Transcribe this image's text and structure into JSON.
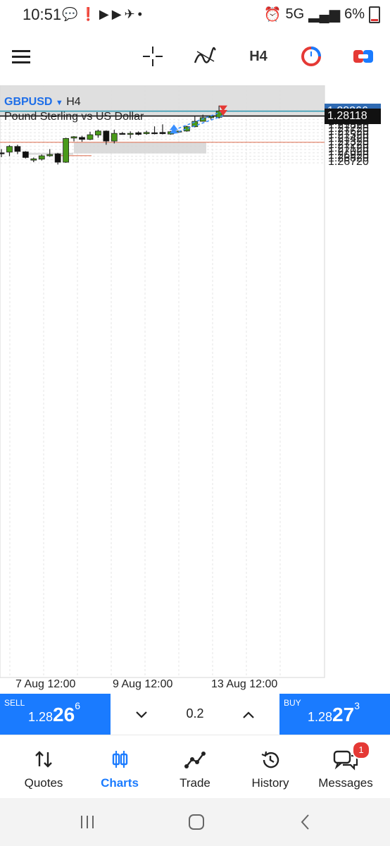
{
  "status": {
    "time": "10:51",
    "left_icons": [
      "chat-bubble-icon",
      "alert-icon",
      "youtube-icon",
      "youtube-icon",
      "flight-icon",
      "dot-icon"
    ],
    "network": "5G",
    "battery": "6%"
  },
  "toolbar": {
    "menu_icon": "menu-icon",
    "crosshair_icon": "crosshair-icon",
    "indicators_icon": "indicators-icon",
    "timeframe": "H4",
    "clock_icon": "trade-clock-icon",
    "trade_icon": "one-click-trade-icon"
  },
  "chart": {
    "symbol": "GBPUSD",
    "timeframe": "H4",
    "description": "Pound Sterling vs US Dollar",
    "price_ticks": [
      "1.28320",
      "1.28220",
      "1.28020",
      "1.27920",
      "1.27820",
      "1.27720",
      "1.27620",
      "1.27520",
      "1.27420",
      "1.27320",
      "1.27220",
      "1.27120",
      "1.27020",
      "1.26920",
      "1.26820",
      "1.26720"
    ],
    "ask_tag": "1.28266",
    "bid_tag": "1.28118",
    "time_ticks": [
      "7 Aug 12:00",
      "9 Aug 12:00",
      "13 Aug 12:00"
    ],
    "colors": {
      "bull": "#4a9a1a",
      "bear": "#111111",
      "ask_line": "#2e9ab3",
      "bid_line": "#111111",
      "entry": "#3a8fff",
      "exit": "#e53935",
      "level": "#e07a5f"
    }
  },
  "chart_data": {
    "type": "candlestick",
    "symbol": "GBPUSD",
    "timeframe": "H4",
    "ylim": [
      1.2664,
      1.2838
    ],
    "candles": [
      {
        "o": 1.2702,
        "h": 1.2713,
        "l": 1.2689,
        "c": 1.2701
      },
      {
        "o": 1.2704,
        "h": 1.2725,
        "l": 1.2692,
        "c": 1.2721
      },
      {
        "o": 1.2721,
        "h": 1.2726,
        "l": 1.2698,
        "c": 1.2706
      },
      {
        "o": 1.2705,
        "h": 1.2707,
        "l": 1.2685,
        "c": 1.2688
      },
      {
        "o": 1.268,
        "h": 1.2688,
        "l": 1.2674,
        "c": 1.2684
      },
      {
        "o": 1.2683,
        "h": 1.2697,
        "l": 1.2679,
        "c": 1.2693
      },
      {
        "o": 1.2693,
        "h": 1.2713,
        "l": 1.269,
        "c": 1.2697
      },
      {
        "o": 1.2699,
        "h": 1.2702,
        "l": 1.2667,
        "c": 1.2674
      },
      {
        "o": 1.2674,
        "h": 1.2747,
        "l": 1.2672,
        "c": 1.2745
      },
      {
        "o": 1.2746,
        "h": 1.2752,
        "l": 1.2736,
        "c": 1.275
      },
      {
        "o": 1.2748,
        "h": 1.2753,
        "l": 1.2735,
        "c": 1.2742
      },
      {
        "o": 1.2742,
        "h": 1.2765,
        "l": 1.274,
        "c": 1.2756
      },
      {
        "o": 1.2755,
        "h": 1.2771,
        "l": 1.2747,
        "c": 1.2767
      },
      {
        "o": 1.2767,
        "h": 1.2769,
        "l": 1.2726,
        "c": 1.2737
      },
      {
        "o": 1.2737,
        "h": 1.2771,
        "l": 1.273,
        "c": 1.276
      },
      {
        "o": 1.276,
        "h": 1.2764,
        "l": 1.2757,
        "c": 1.2758
      },
      {
        "o": 1.2758,
        "h": 1.2766,
        "l": 1.2745,
        "c": 1.276
      },
      {
        "o": 1.2762,
        "h": 1.2766,
        "l": 1.2754,
        "c": 1.2757
      },
      {
        "o": 1.2759,
        "h": 1.2768,
        "l": 1.2756,
        "c": 1.2763
      },
      {
        "o": 1.2762,
        "h": 1.2781,
        "l": 1.2757,
        "c": 1.2761
      },
      {
        "o": 1.2763,
        "h": 1.2787,
        "l": 1.2757,
        "c": 1.2759
      },
      {
        "o": 1.2758,
        "h": 1.2767,
        "l": 1.2756,
        "c": 1.2765
      },
      {
        "o": 1.2765,
        "h": 1.2768,
        "l": 1.2762,
        "c": 1.2767
      },
      {
        "o": 1.2767,
        "h": 1.2783,
        "l": 1.2765,
        "c": 1.278
      },
      {
        "o": 1.278,
        "h": 1.2811,
        "l": 1.2778,
        "c": 1.2796
      },
      {
        "o": 1.2796,
        "h": 1.2816,
        "l": 1.2802,
        "c": 1.2807
      },
      {
        "o": 1.2807,
        "h": 1.2812,
        "l": 1.2801,
        "c": 1.2811
      },
      {
        "o": 1.2808,
        "h": 1.2843,
        "l": 1.2804,
        "c": 1.28266
      }
    ],
    "time_labels": [
      "7 Aug 12:00",
      "9 Aug 12:00",
      "13 Aug 12:00"
    ]
  },
  "trade": {
    "sell_label": "SELL",
    "sell_prefix": "1.28",
    "sell_big": "26",
    "sell_sup": "6",
    "buy_label": "BUY",
    "buy_prefix": "1.28",
    "buy_big": "27",
    "buy_sup": "3",
    "volume": "0.2"
  },
  "nav": {
    "items": [
      {
        "label": "Quotes",
        "icon": "quotes-icon"
      },
      {
        "label": "Charts",
        "icon": "charts-icon"
      },
      {
        "label": "Trade",
        "icon": "trade-icon"
      },
      {
        "label": "History",
        "icon": "history-icon"
      },
      {
        "label": "Messages",
        "icon": "messages-icon"
      }
    ],
    "active": "Charts",
    "messages_badge": "1"
  }
}
